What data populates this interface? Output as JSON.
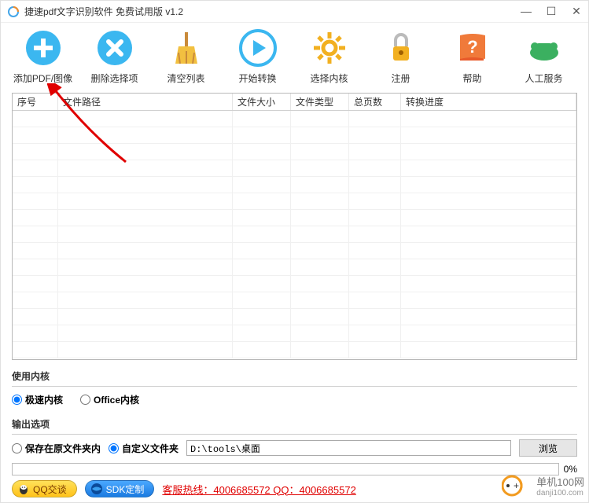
{
  "title": "捷速pdf文字识别软件 免费试用版 v1.2",
  "toolbar": [
    {
      "label": "添加PDF/图像",
      "name": "add-pdf-button"
    },
    {
      "label": "删除选择项",
      "name": "delete-button"
    },
    {
      "label": "清空列表",
      "name": "clear-button"
    },
    {
      "label": "开始转换",
      "name": "start-button"
    },
    {
      "label": "选择内核",
      "name": "kernel-button"
    },
    {
      "label": "注册",
      "name": "register-button"
    },
    {
      "label": "帮助",
      "name": "help-button"
    },
    {
      "label": "人工服务",
      "name": "service-button"
    }
  ],
  "columns": {
    "idx": "序号",
    "path": "文件路径",
    "size": "文件大小",
    "type": "文件类型",
    "pages": "总页数",
    "progress": "转换进度"
  },
  "kernel": {
    "label": "使用内核",
    "fast": "极速内核",
    "office": "Office内核"
  },
  "output": {
    "label": "输出选项",
    "keep": "保存在原文件夹内",
    "custom": "自定义文件夹",
    "path": "D:\\tools\\桌面",
    "browse": "浏览"
  },
  "progress_pct": "0%",
  "footer": {
    "qq": "QQ交谈",
    "sdk": "SDK定制",
    "hotline": "客服热线：4006685572 QQ：4006685572"
  },
  "watermark": {
    "brand": "单机100网",
    "url": "danji100.com"
  }
}
